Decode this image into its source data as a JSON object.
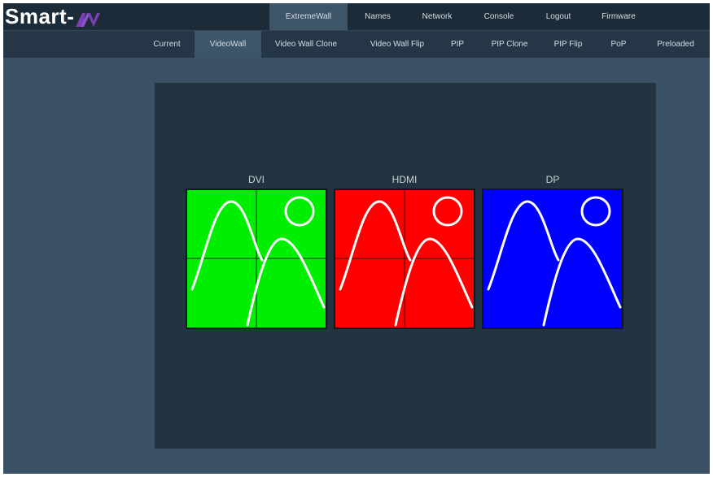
{
  "brand": {
    "logo_text": "Smart-",
    "logo_mark": "AV-logo-mark",
    "mark_color": "#7b3fb4"
  },
  "top_nav": {
    "items": [
      {
        "label": "ExtremeWall",
        "active": true
      },
      {
        "label": "Names",
        "active": false
      },
      {
        "label": "Network",
        "active": false
      },
      {
        "label": "Console",
        "active": false
      },
      {
        "label": "Logout",
        "active": false
      },
      {
        "label": "Firmware",
        "active": false
      }
    ]
  },
  "sub_nav": {
    "items": [
      {
        "label": "Current",
        "active": false
      },
      {
        "label": "VideoWall",
        "active": true
      },
      {
        "label": "Video Wall Clone",
        "active": false
      },
      {
        "label": "Video Wall Flip",
        "active": false
      },
      {
        "label": "PIP",
        "active": false
      },
      {
        "label": "PIP Clone",
        "active": false
      },
      {
        "label": "PIP Flip",
        "active": false
      },
      {
        "label": "PoP",
        "active": false
      },
      {
        "label": "Preloaded",
        "active": false
      }
    ]
  },
  "sources": [
    {
      "label": "DVI",
      "color": "#00ee00",
      "grid": true,
      "icon": "image-placeholder-icon"
    },
    {
      "label": "HDMI",
      "color": "#ff0000",
      "grid": true,
      "icon": "image-placeholder-icon"
    },
    {
      "label": "DP",
      "color": "#0000ff",
      "grid": false,
      "icon": "image-placeholder-icon"
    }
  ],
  "colors": {
    "background": "#3b5266",
    "header": "#1b2b38",
    "subheader": "#253746",
    "panel": "#233441",
    "active_tab": "#3d5568"
  }
}
